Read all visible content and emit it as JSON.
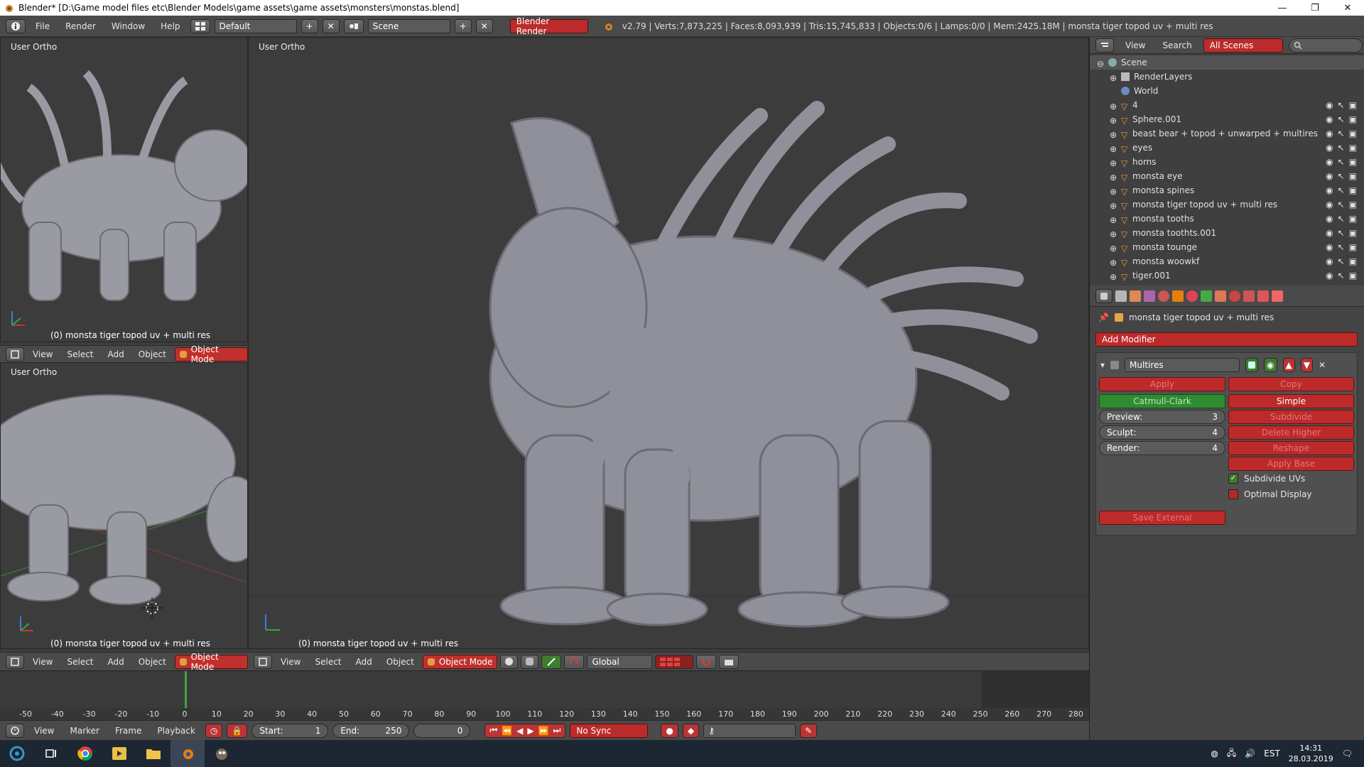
{
  "window": {
    "title": "Blender* [D:\\Game model files etc\\Blender Models\\game assets\\game assets\\monsters\\monstas.blend]",
    "minimize": "—",
    "maximize": "❐",
    "close": "✕"
  },
  "infobar": {
    "menus": [
      "File",
      "Render",
      "Window",
      "Help"
    ],
    "layout": "Default",
    "scene": "Scene",
    "engine": "Blender Render",
    "stats": "v2.79 | Verts:7,873,225 | Faces:8,093,939 | Tris:15,745,833 | Objects:0/6 | Lamps:0/0 | Mem:2425.18M | monsta tiger topod uv + multi res"
  },
  "viewports": {
    "top_left": {
      "label": "User Ortho",
      "object": "(0) monsta tiger topod uv + multi res"
    },
    "bottom_left": {
      "label": "User Ortho",
      "object": "(0) monsta tiger topod uv + multi res"
    },
    "main": {
      "label": "User Ortho",
      "object": "(0) monsta tiger topod uv + multi res"
    }
  },
  "view_header": {
    "menus": [
      "View",
      "Select",
      "Add",
      "Object"
    ],
    "mode": "Object Mode",
    "orientation": "Global"
  },
  "outliner": {
    "menus": [
      "View",
      "Search"
    ],
    "filter": "All Scenes",
    "items": [
      {
        "label": "Scene",
        "type": "scene"
      },
      {
        "label": "RenderLayers",
        "type": "renderlayers"
      },
      {
        "label": "World",
        "type": "world"
      },
      {
        "label": "4",
        "type": "mesh"
      },
      {
        "label": "Sphere.001",
        "type": "mesh"
      },
      {
        "label": "beast bear + topod + unwarped + multires",
        "type": "mesh"
      },
      {
        "label": "eyes",
        "type": "mesh"
      },
      {
        "label": "horns",
        "type": "mesh"
      },
      {
        "label": "monsta eye",
        "type": "mesh"
      },
      {
        "label": "monsta spines",
        "type": "mesh"
      },
      {
        "label": "monsta tiger topod uv + multi res",
        "type": "mesh"
      },
      {
        "label": "monsta tooths",
        "type": "mesh"
      },
      {
        "label": "monsta toothts.001",
        "type": "mesh"
      },
      {
        "label": "monsta tounge",
        "type": "mesh"
      },
      {
        "label": "monsta woowkf",
        "type": "mesh"
      },
      {
        "label": "tiger.001",
        "type": "mesh"
      }
    ]
  },
  "properties": {
    "breadcrumb": "monsta tiger topod uv + multi res",
    "add_modifier": "Add Modifier",
    "modifier_name": "Multires",
    "apply": "Apply",
    "copy": "Copy",
    "catmull": "Catmull-Clark",
    "simple": "Simple",
    "preview_label": "Preview:",
    "preview_value": "3",
    "sculpt_label": "Sculpt:",
    "sculpt_value": "4",
    "render_label": "Render:",
    "render_value": "4",
    "subdivide": "Subdivide",
    "delete_higher": "Delete Higher",
    "reshape": "Reshape",
    "apply_base": "Apply Base",
    "subdivide_uvs": "Subdivide UVs",
    "subdivide_uvs_checked": true,
    "optimal_display": "Optimal Display",
    "optimal_display_checked": false,
    "save_external": "Save External"
  },
  "timeline": {
    "ticks": [
      "-50",
      "-40",
      "-30",
      "-20",
      "-10",
      "0",
      "10",
      "20",
      "30",
      "40",
      "50",
      "60",
      "70",
      "80",
      "90",
      "100",
      "110",
      "120",
      "130",
      "140",
      "150",
      "160",
      "170",
      "180",
      "190",
      "200",
      "210",
      "220",
      "230",
      "240",
      "250",
      "260",
      "270",
      "280"
    ],
    "menus": [
      "View",
      "Marker",
      "Frame",
      "Playback"
    ],
    "start_label": "Start:",
    "start_value": "1",
    "end_label": "End:",
    "end_value": "250",
    "current": "0",
    "sync": "No Sync"
  },
  "taskbar": {
    "lang": "EST",
    "time": "14:31",
    "date": "28.03.2019"
  },
  "colors": {
    "accent_red": "#bd2a2a",
    "accent_green": "#2e8c30",
    "viewport_bg": "#3c3c3c",
    "panel_bg": "#444444"
  }
}
